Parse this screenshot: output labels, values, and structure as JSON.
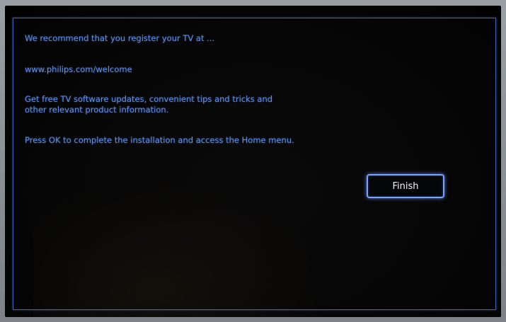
{
  "dialog": {
    "line1": "We recommend that you register your TV at ...",
    "url": "www.philips.com/welcome",
    "benefits_line1": "Get free TV software updates, convenient tips and tricks and",
    "benefits_line2": "other relevant product information.",
    "instruction": "Press OK to complete the installation and access the Home menu.",
    "finish_label": "Finish"
  },
  "colors": {
    "text": "#5f8fe8",
    "border": "#3f63b8",
    "button_border": "#7aa2ff",
    "button_text": "#f2f5ff"
  }
}
